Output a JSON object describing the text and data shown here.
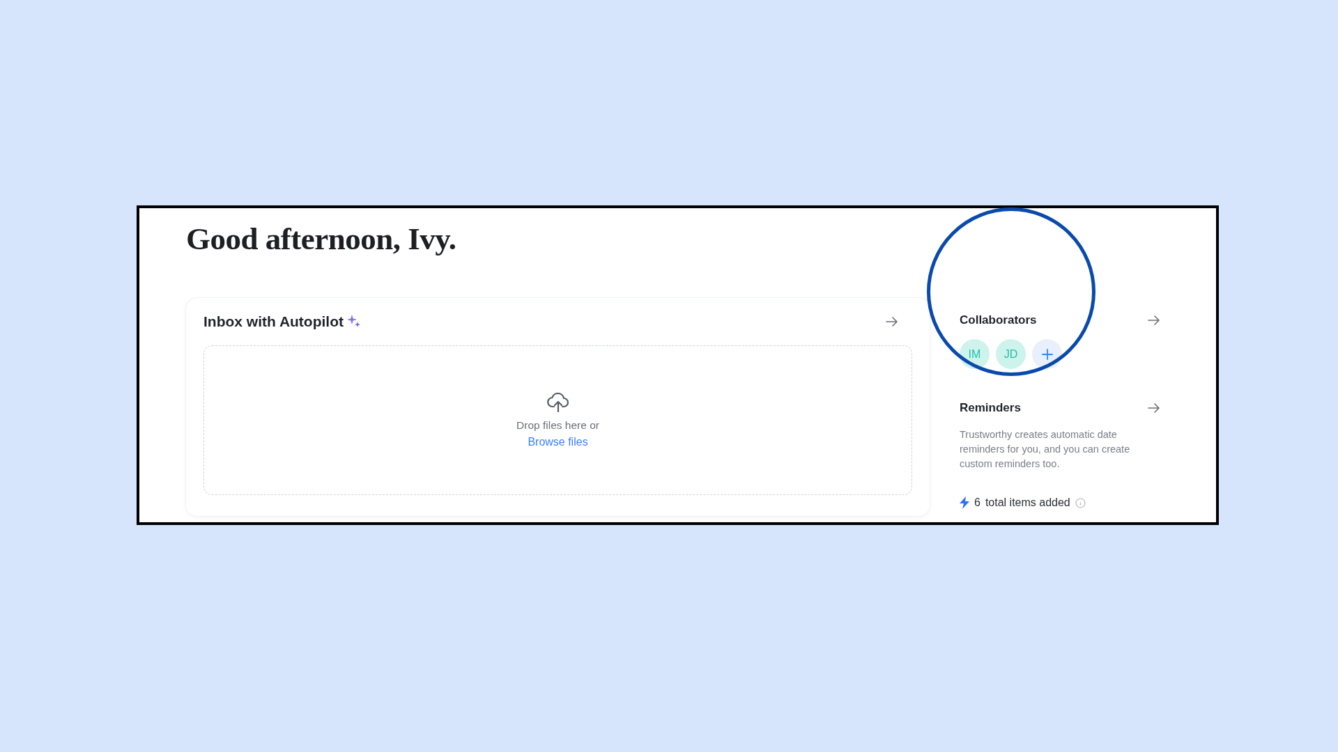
{
  "greeting": "Good afternoon, Ivy.",
  "inbox": {
    "title": "Inbox with Autopilot",
    "dropzone": {
      "prompt": "Drop files here or",
      "link": "Browse files"
    }
  },
  "collaborators": {
    "title": "Collaborators",
    "avatars": [
      {
        "kind": "person",
        "initials": "IM"
      },
      {
        "kind": "person",
        "initials": "JD"
      },
      {
        "kind": "add"
      }
    ]
  },
  "reminders": {
    "title": "Reminders",
    "description": "Trustworthy creates automatic date reminders for you, and you can create custom reminders too.",
    "stat": {
      "count": "6",
      "label": "total items added"
    }
  }
}
